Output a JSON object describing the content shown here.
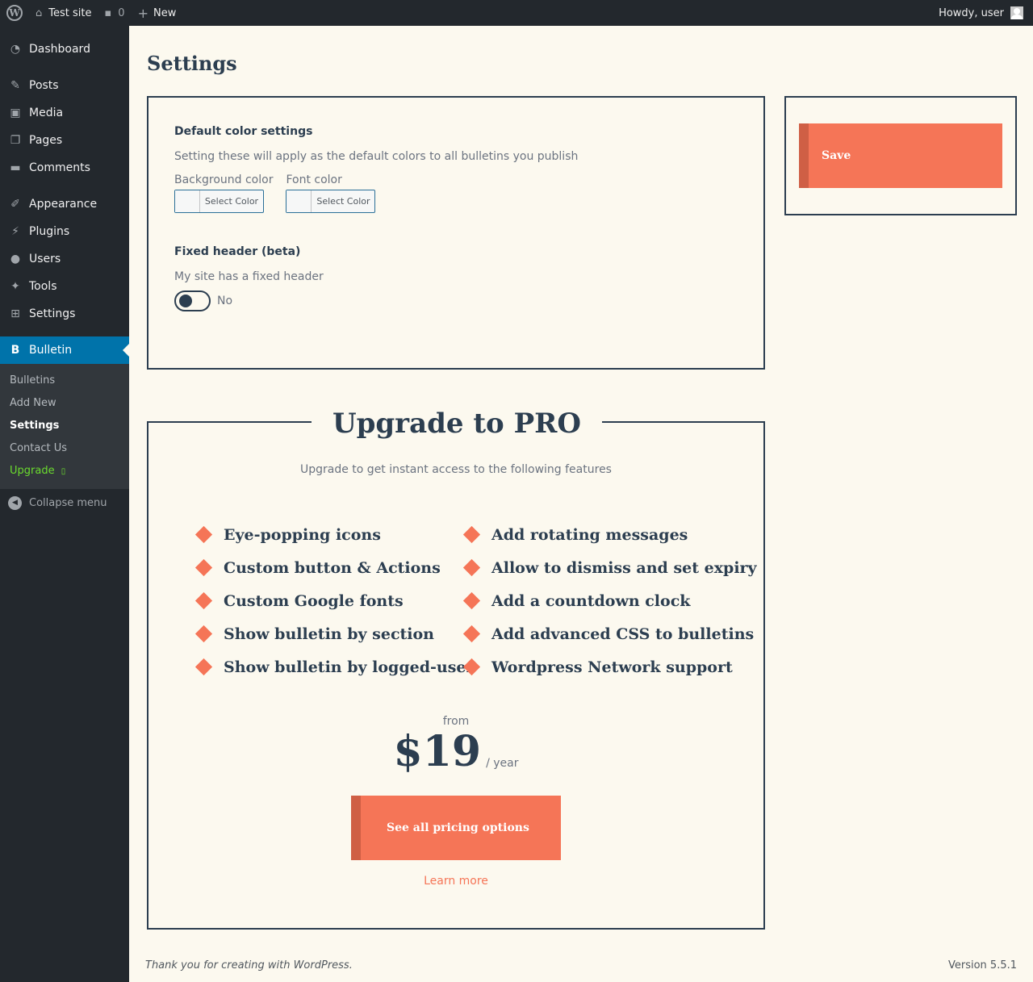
{
  "adminbar": {
    "site_name": "Test site",
    "comments_count": "0",
    "new_label": "New",
    "howdy": "Howdy, user"
  },
  "sidebar": {
    "items": [
      {
        "label": "Dashboard",
        "icon": "dashboard-icon"
      },
      {
        "label": "Posts",
        "icon": "pin-icon"
      },
      {
        "label": "Media",
        "icon": "media-icon"
      },
      {
        "label": "Pages",
        "icon": "pages-icon"
      },
      {
        "label": "Comments",
        "icon": "comment-icon"
      },
      {
        "label": "Appearance",
        "icon": "brush-icon"
      },
      {
        "label": "Plugins",
        "icon": "plug-icon"
      },
      {
        "label": "Users",
        "icon": "user-icon"
      },
      {
        "label": "Tools",
        "icon": "wrench-icon"
      },
      {
        "label": "Settings",
        "icon": "sliders-icon"
      },
      {
        "label": "Bulletin",
        "icon": "bulletin-icon"
      }
    ],
    "submenu": [
      "Bulletins",
      "Add New",
      "Settings",
      "Contact Us",
      "Upgrade"
    ],
    "collapse_label": "Collapse menu"
  },
  "page": {
    "title": "Settings"
  },
  "color_settings": {
    "heading": "Default color settings",
    "description": "Setting these will apply as the default colors to all bulletins you publish",
    "background_label": "Background color",
    "font_label": "Font color",
    "select_color": "Select Color",
    "fixed_heading": "Fixed header (beta)",
    "fixed_description": "My site has a fixed header",
    "toggle_value": "No"
  },
  "save": {
    "label": "Save"
  },
  "upgrade": {
    "title": "Upgrade to PRO",
    "subtitle": "Upgrade to get instant access to the following features",
    "features_left": [
      "Eye-popping icons",
      "Custom button & Actions",
      "Custom Google fonts",
      "Show bulletin by section",
      "Show bulletin by logged-user"
    ],
    "features_right": [
      "Add rotating messages",
      "Allow to dismiss and set expiry",
      "Add a countdown clock",
      "Add advanced CSS to bulletins",
      "Wordpress Network support"
    ],
    "price_from": "from",
    "price": "$19",
    "per": "/ year",
    "pricing_button": "See all pricing options",
    "learn_more": "Learn more"
  },
  "footer": {
    "left": "Thank you for creating with WordPress.",
    "version": "Version 5.5.1"
  },
  "colors": {
    "accent": "#f57557",
    "navy": "#2c3e50",
    "admin_dark": "#23282d",
    "admin_blue": "#0073aa"
  }
}
